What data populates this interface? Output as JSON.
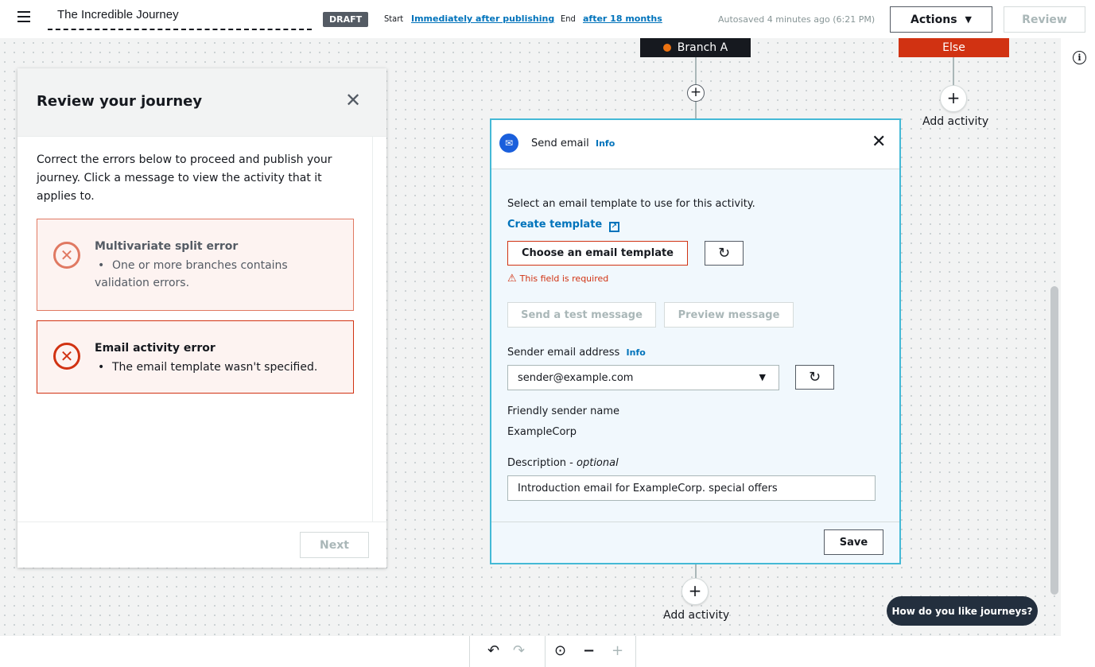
{
  "header": {
    "journey_title": "The Incredible Journey",
    "status_badge": "DRAFT",
    "start_label": "Start",
    "start_value": "Immediately after publishing",
    "end_label": "End",
    "end_value": "after 18 months",
    "autosave_text": "Autosaved 4 minutes ago (6:21 PM)",
    "actions_label": "Actions",
    "review_label": "Review"
  },
  "canvas": {
    "branch_a_label": "Branch A",
    "else_label": "Else",
    "add_activity_label": "Add activity",
    "add_activity_bottom_label": "Add activity",
    "feedback_label": "How do you like journeys?",
    "colors": {
      "branch_dot": "#ec7211",
      "else_bg": "#d13212",
      "card_border": "#44b9d6"
    }
  },
  "review_panel": {
    "title": "Review your journey",
    "intro": "Correct the errors below to proceed and publish your journey. Click a message to view the activity that it applies to.",
    "errors": [
      {
        "title": "Multivariate split error",
        "message": "One or more branches contains validation errors."
      },
      {
        "title": "Email activity error",
        "message": "The email template wasn't specified."
      }
    ],
    "next_label": "Next"
  },
  "email_card": {
    "title": "Send email",
    "info_label": "Info",
    "template_prompt": "Select an email template to use for this activity.",
    "create_template_label": "Create template",
    "choose_template_label": "Choose an email template",
    "required_warning": "This field is required",
    "send_test_label": "Send a test message",
    "preview_label": "Preview message",
    "sender_label": "Sender email address",
    "sender_info_label": "Info",
    "sender_value": "sender@example.com",
    "friendly_name_label": "Friendly sender name",
    "friendly_name_value": "ExampleCorp",
    "description_label": "Description -",
    "description_optional": "optional",
    "description_value": "Introduction email for ExampleCorp. special offers",
    "save_label": "Save"
  }
}
